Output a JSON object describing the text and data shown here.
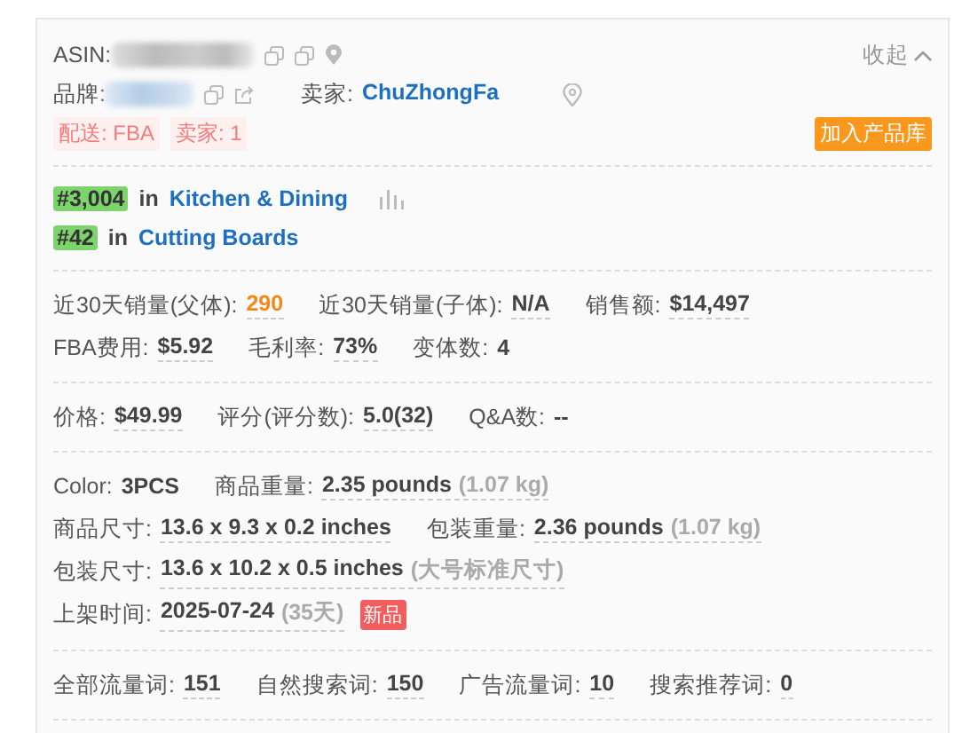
{
  "asin": {
    "label": "ASIN:"
  },
  "brand": {
    "label": "品牌:"
  },
  "seller": {
    "label": "卖家:",
    "name": "ChuZhongFa"
  },
  "collapse": {
    "label": "收起"
  },
  "tags": [
    {
      "text": "配送: FBA"
    },
    {
      "text": "卖家: 1"
    }
  ],
  "add_button": {
    "label": "加入产品库"
  },
  "ranks": [
    {
      "rank": "#3,004",
      "prep": "in",
      "category": "Kitchen & Dining",
      "chart_icon": true
    },
    {
      "rank": "#42",
      "prep": "in",
      "category": "Cutting Boards",
      "chart_icon": false
    }
  ],
  "sections": [
    {
      "rows": [
        {
          "fields": [
            {
              "label": "近30天销量(父体):",
              "value": "290",
              "kind": "accent",
              "underline": true
            },
            {
              "label": "近30天销量(子体):",
              "value": "N/A",
              "kind": "plain",
              "underline": true
            },
            {
              "label": "销售额:",
              "value": "$14,497",
              "kind": "plain",
              "underline": true
            }
          ]
        },
        {
          "fields": [
            {
              "label": "FBA费用:",
              "value": "$5.92",
              "kind": "plain",
              "underline": true
            },
            {
              "label": "毛利率:",
              "value": "73%",
              "kind": "plain",
              "underline": true
            },
            {
              "label": "变体数:",
              "value": "4",
              "kind": "plain",
              "underline": false
            }
          ]
        }
      ]
    },
    {
      "rows": [
        {
          "fields": [
            {
              "label": "价格:",
              "value": "$49.99",
              "kind": "plain",
              "underline": true
            },
            {
              "label": "评分(评分数):",
              "value": "5.0(32)",
              "kind": "plain",
              "underline": true
            },
            {
              "label": "Q&A数:",
              "value": "--",
              "kind": "plain",
              "underline": false
            }
          ]
        }
      ]
    },
    {
      "rows": [
        {
          "fields": [
            {
              "label": "Color:",
              "value": "3PCS",
              "kind": "plain",
              "underline": false
            },
            {
              "label": "商品重量:",
              "value": "2.35 pounds",
              "note": "(1.07 kg)",
              "kind": "plain",
              "underline": true
            }
          ]
        },
        {
          "fields": [
            {
              "label": "商品尺寸:",
              "value": "13.6 x 9.3 x 0.2 inches",
              "kind": "plain",
              "underline": true
            },
            {
              "label": "包装重量:",
              "value": "2.36 pounds",
              "note": "(1.07 kg)",
              "kind": "plain",
              "underline": true
            }
          ]
        },
        {
          "fields": [
            {
              "label": "包装尺寸:",
              "value": "13.6 x 10.2 x 0.5 inches",
              "note": "(大号标准尺寸)",
              "kind": "plain",
              "underline": true
            }
          ]
        },
        {
          "fields": [
            {
              "label": "上架时间:",
              "value": "2025-07-24",
              "note": "(35天)",
              "badge": "新品",
              "kind": "plain",
              "underline": true
            }
          ]
        }
      ]
    },
    {
      "rows": [
        {
          "fields": [
            {
              "label": "全部流量词:",
              "value": "151",
              "kind": "plain",
              "underline": true
            },
            {
              "label": "自然搜索词:",
              "value": "150",
              "kind": "plain",
              "underline": true
            },
            {
              "label": "广告流量词:",
              "value": "10",
              "kind": "plain",
              "underline": true
            },
            {
              "label": "搜索推荐词:",
              "value": "0",
              "kind": "plain",
              "underline": true
            }
          ]
        }
      ]
    }
  ]
}
